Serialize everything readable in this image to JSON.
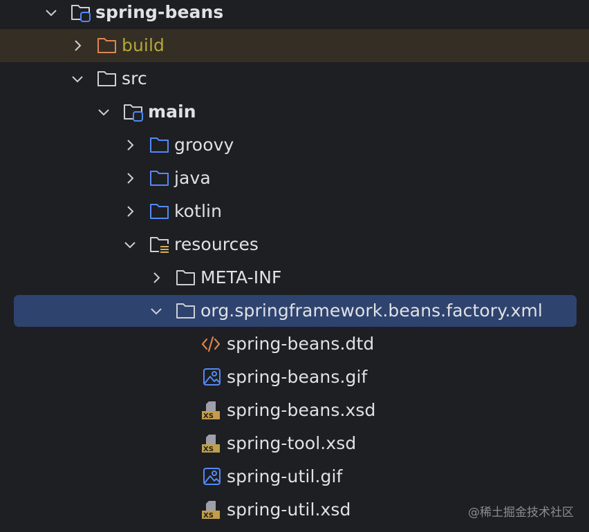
{
  "tree": {
    "items": [
      {
        "label": "spring-beans",
        "icon": "module-folder-icon",
        "expanded": true
      },
      {
        "label": "build",
        "icon": "excluded-folder-icon",
        "expanded": false
      },
      {
        "label": "src",
        "icon": "folder-icon",
        "expanded": true
      },
      {
        "label": "main",
        "icon": "source-root-folder-icon",
        "expanded": true
      },
      {
        "label": "groovy",
        "icon": "source-folder-icon",
        "expanded": false
      },
      {
        "label": "java",
        "icon": "source-folder-icon",
        "expanded": false
      },
      {
        "label": "kotlin",
        "icon": "source-folder-icon",
        "expanded": false
      },
      {
        "label": "resources",
        "icon": "resources-folder-icon",
        "expanded": true
      },
      {
        "label": "META-INF",
        "icon": "folder-icon",
        "expanded": false
      },
      {
        "label": "org.springframework.beans.factory.xml",
        "icon": "folder-icon",
        "expanded": true,
        "selected": true
      },
      {
        "label": "spring-beans.dtd",
        "icon": "dtd-file-icon"
      },
      {
        "label": "spring-beans.gif",
        "icon": "image-file-icon"
      },
      {
        "label": "spring-beans.xsd",
        "icon": "xsd-file-icon"
      },
      {
        "label": "spring-tool.xsd",
        "icon": "xsd-file-icon"
      },
      {
        "label": "spring-util.gif",
        "icon": "image-file-icon"
      },
      {
        "label": "spring-util.xsd",
        "icon": "xsd-file-icon"
      }
    ]
  },
  "watermark": {
    "text": "@稀土掘金技术社区"
  },
  "colors": {
    "background": "#1e1f22",
    "excluded_row": "#352e24",
    "selection": "#2e436e",
    "text": "#dfe1e5",
    "excluded_text": "#b4a83a",
    "folder_stroke": "#ced0d6",
    "source_folder": "#548af7",
    "excluded_folder": "#e08855",
    "xml_orange": "#d8844c",
    "xsd_badge": "#c29e4a"
  }
}
